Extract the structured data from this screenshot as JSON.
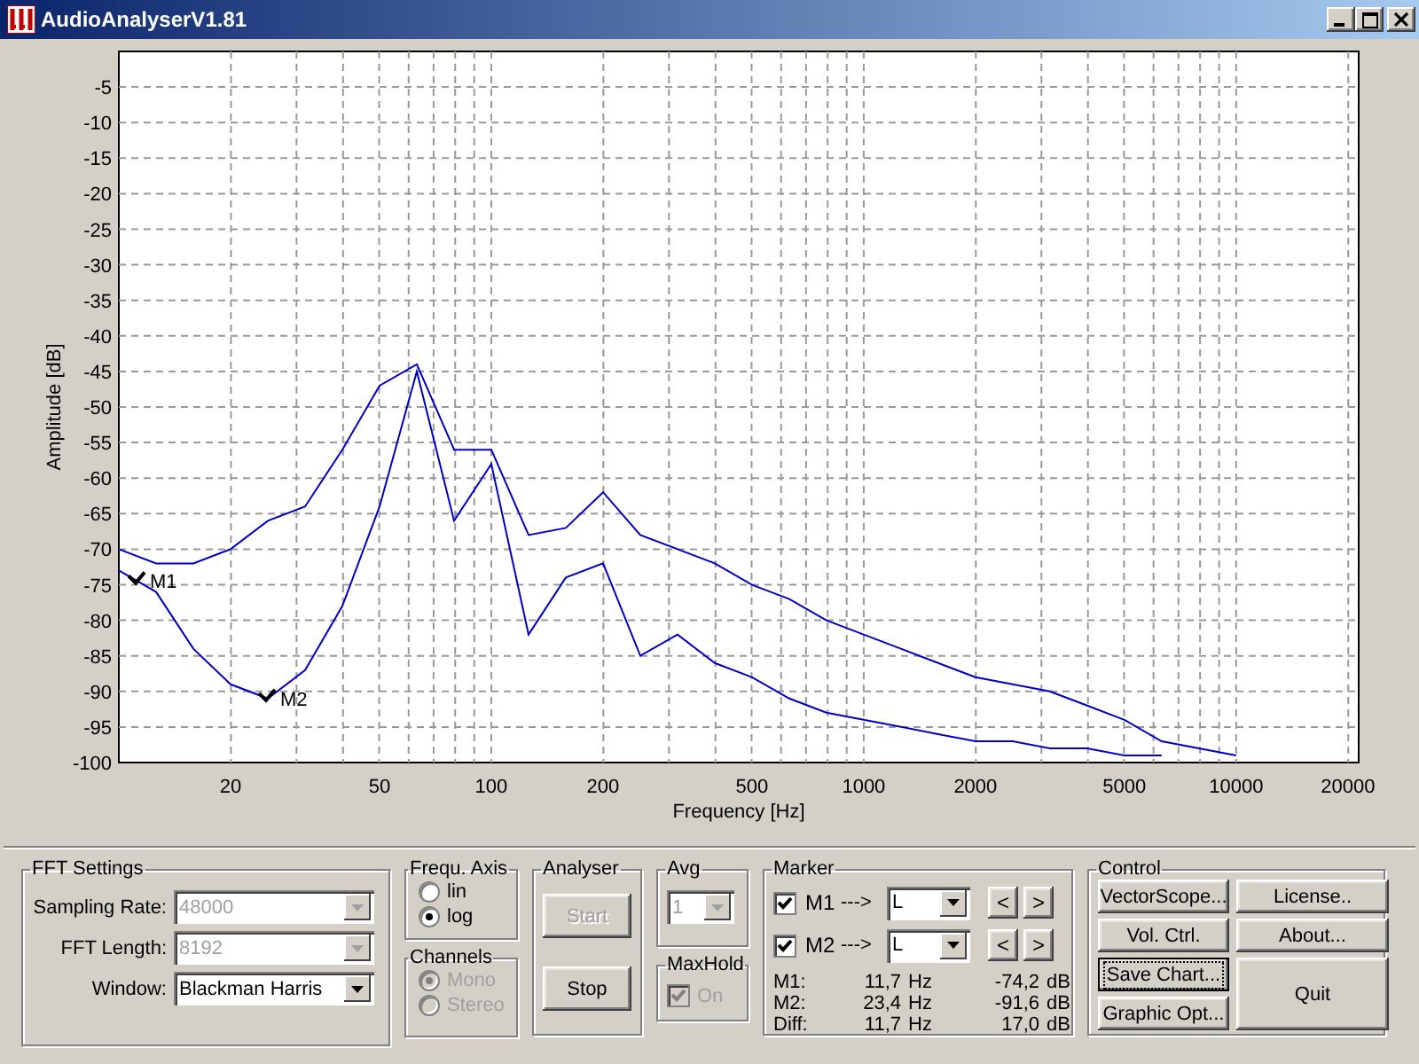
{
  "window": {
    "title": "AudioAnalyserV1.81"
  },
  "chart": {
    "chart_data": {
      "type": "line",
      "xlabel": "Frequency [Hz]",
      "ylabel": "Amplitude [dB]",
      "categories": [
        null,
        null,
        null,
        "20",
        null,
        null,
        null,
        "50",
        null,
        null,
        "100",
        null,
        null,
        "200",
        null,
        null,
        null,
        "500",
        null,
        null,
        "1000",
        null,
        null,
        "2000",
        null,
        null,
        null,
        "5000",
        null,
        null,
        "10000",
        null,
        null,
        "20000"
      ],
      "series": [
        {
          "color": "#0000c8",
          "values": [
            -70,
            -72,
            -72,
            -70,
            -66,
            -64,
            -56,
            -47,
            -44,
            -56,
            -56,
            -68,
            -67,
            -62,
            -68,
            -70,
            -72,
            -75,
            -77,
            -80,
            -82,
            -84,
            -86,
            -88,
            -89,
            -90,
            -92,
            -94,
            -97,
            -98,
            -99,
            null,
            null,
            null
          ]
        },
        {
          "color": "#0000c8",
          "values": [
            -73,
            -76,
            -84,
            -89,
            -91,
            -87,
            -78,
            -64,
            -45,
            -66,
            -58,
            -82,
            -74,
            -72,
            -85,
            -82,
            -86,
            -88,
            -91,
            -93,
            -94,
            -95,
            -96,
            -97,
            -97,
            -98,
            -98,
            -99,
            -99,
            null,
            null,
            null,
            null,
            null
          ]
        }
      ],
      "ylim": [
        -100,
        0
      ],
      "yticks": [
        -100,
        -95,
        -90,
        -85,
        -80,
        -75,
        -70,
        -65,
        -60,
        -55,
        -50,
        -45,
        -40,
        -35,
        -30,
        -25,
        -20,
        -15,
        -10,
        -5
      ],
      "grid": true,
      "annotations": [
        "M1",
        "M2"
      ]
    }
  },
  "fft_settings": {
    "title": "FFT Settings",
    "fields": [
      {
        "label": "Sampling Rate:",
        "value": "48000",
        "disabled": true
      },
      {
        "label": "FFT Length:",
        "value": "8192",
        "disabled": true
      },
      {
        "label": "Window:",
        "value": "Blackman Harris",
        "disabled": false
      }
    ]
  },
  "frequ_axis": {
    "title": "Frequ. Axis",
    "options": [
      {
        "label": "lin",
        "selected": false,
        "disabled": false
      },
      {
        "label": "log",
        "selected": true,
        "disabled": false
      }
    ]
  },
  "channels": {
    "title": "Channels",
    "options": [
      {
        "label": "Mono",
        "selected": true,
        "disabled": true
      },
      {
        "label": "Stereo",
        "selected": false,
        "disabled": true
      }
    ]
  },
  "analyser": {
    "title": "Analyser",
    "buttons": [
      {
        "label": "Start",
        "disabled": true
      },
      {
        "label": "Stop",
        "disabled": false
      }
    ]
  },
  "avg": {
    "title": "Avg",
    "value": "1",
    "disabled": true
  },
  "maxhold": {
    "title": "MaxHold",
    "label": "On",
    "checked": true,
    "disabled": true
  },
  "marker": {
    "title": "Marker",
    "markers": [
      {
        "label": "M1",
        "checked": true,
        "arrow": "--->",
        "channel": "L",
        "prev": "<",
        "next": ">"
      },
      {
        "label": "M2",
        "checked": true,
        "arrow": "--->",
        "channel": "L",
        "prev": "<",
        "next": ">"
      }
    ],
    "readouts": [
      {
        "label": "M1:",
        "freq": "11,7",
        "freq_unit": "Hz",
        "amplitude": "-74,2",
        "amp_unit": "dB"
      },
      {
        "label": "M2:",
        "freq": "23,4",
        "freq_unit": "Hz",
        "amplitude": "-91,6",
        "amp_unit": "dB"
      },
      {
        "label": "Diff:",
        "freq": "11,7",
        "freq_unit": "Hz",
        "amplitude": "17,0",
        "amp_unit": "dB"
      }
    ]
  },
  "control": {
    "title": "Control",
    "left_buttons": [
      {
        "label": "VectorScope...",
        "focused": false
      },
      {
        "label": "Vol. Ctrl.",
        "focused": false
      },
      {
        "label": "Save Chart...",
        "focused": true
      },
      {
        "label": "Graphic Opt...",
        "focused": false
      }
    ],
    "right_buttons": [
      {
        "label": "License..",
        "kind": "normal"
      },
      {
        "label": "About...",
        "kind": "normal"
      },
      {
        "label": "Quit",
        "kind": "tall"
      }
    ]
  }
}
